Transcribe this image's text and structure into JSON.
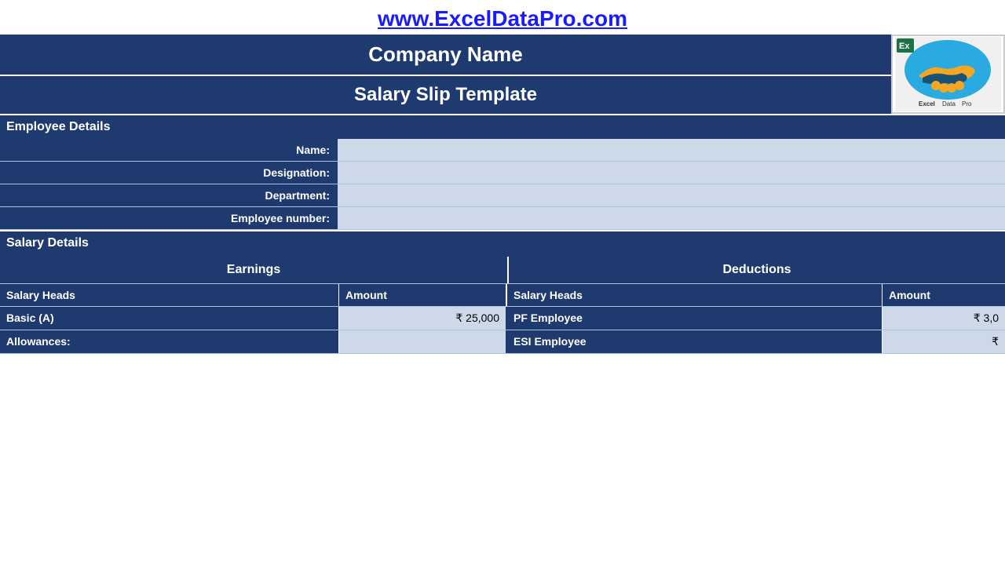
{
  "header": {
    "website_url": "www.ExcelDataPro.com",
    "website_href": "http://www.ExcelDataPro.com"
  },
  "company": {
    "name": "Company Name",
    "slip_title": "Salary Slip Template"
  },
  "employee_details": {
    "section_label": "Employee Details",
    "fields": [
      {
        "label": "Name:",
        "value": ""
      },
      {
        "label": "Designation:",
        "value": ""
      },
      {
        "label": "Department:",
        "value": ""
      },
      {
        "label": "Employee number:",
        "value_small": "",
        "value_large": ""
      }
    ]
  },
  "salary_details": {
    "section_label": "Salary Details",
    "earnings_header": "Earnings",
    "deductions_header": "Deductions",
    "col_salary_heads": "Salary Heads",
    "col_amount": "Amount",
    "earnings_rows": [
      {
        "head": "Basic (A)",
        "amount": "₹   25,000"
      },
      {
        "head": "Allowances:",
        "amount": ""
      }
    ],
    "deductions_rows": [
      {
        "head": "PF Employee",
        "amount": "₹   3,0"
      },
      {
        "head": "ESI Employee",
        "amount": "₹"
      }
    ]
  },
  "logo": {
    "alt": "ExcelDataPro Logo"
  }
}
